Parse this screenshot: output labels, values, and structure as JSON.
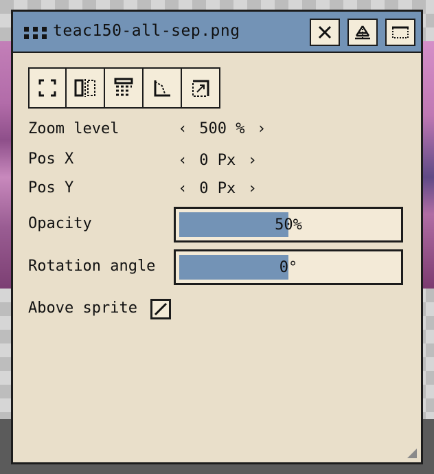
{
  "window": {
    "title": "teac150-all-sep.png",
    "accent_color": "#7393b6",
    "panel_color": "#e9dfca"
  },
  "titlebar_buttons": [
    {
      "icon": "close-icon"
    },
    {
      "icon": "restore-icon"
    },
    {
      "icon": "collapse-icon"
    }
  ],
  "toolbar": {
    "tools": [
      {
        "icon": "fit-screen-icon"
      },
      {
        "icon": "flip-horizontal-icon"
      },
      {
        "icon": "align-grid-icon"
      },
      {
        "icon": "angle-icon"
      },
      {
        "icon": "crop-corner-icon"
      }
    ]
  },
  "properties": {
    "zoom": {
      "label": "Zoom level",
      "left": "‹",
      "value": "500 %",
      "right": "›"
    },
    "pos_x": {
      "label": "Pos X",
      "left": "‹",
      "value": "0 Px",
      "right": "›"
    },
    "pos_y": {
      "label": "Pos Y",
      "left": "‹",
      "value": "0 Px",
      "right": "›"
    },
    "opacity": {
      "label": "Opacity",
      "value_text": "50%",
      "fraction": 0.5
    },
    "rotation": {
      "label": "Rotation angle",
      "value_text": "0°",
      "fraction": 0.5
    },
    "above_sprite": {
      "label": "Above sprite",
      "checked": true
    }
  }
}
